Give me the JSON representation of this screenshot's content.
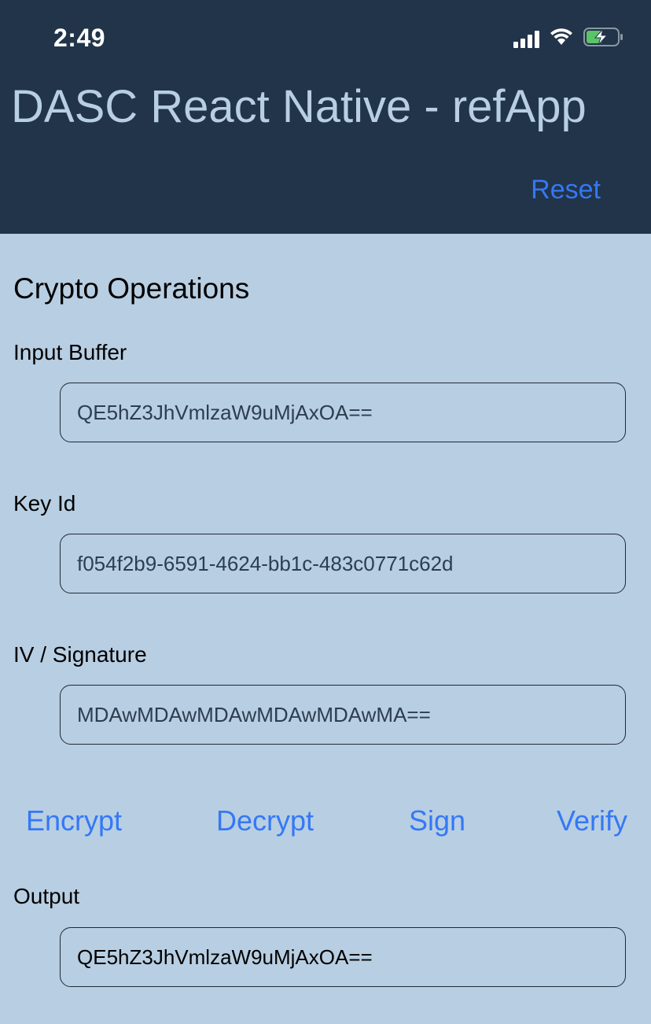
{
  "status_bar": {
    "time": "2:49",
    "icons": [
      "signal-icon",
      "wifi-icon",
      "battery-charging-icon"
    ]
  },
  "header": {
    "title": "DASC React Native - refApp",
    "reset_label": "Reset",
    "background": "#213449",
    "title_color": "#b8cee2"
  },
  "main": {
    "background": "#b8cee2",
    "section_title": "Crypto Operations",
    "input_buffer": {
      "label": "Input Buffer",
      "value": "QE5hZ3JhVmlzaW9uMjAxOA=="
    },
    "key_id": {
      "label": "Key Id",
      "value": "f054f2b9-6591-4624-bb1c-483c0771c62d"
    },
    "iv_signature": {
      "label": "IV / Signature",
      "value": "MDAwMDAwMDAwMDAwMDAwMA=="
    },
    "actions": {
      "encrypt": "Encrypt",
      "decrypt": "Decrypt",
      "sign": "Sign",
      "verify": "Verify"
    },
    "output": {
      "label": "Output",
      "value": "QE5hZ3JhVmlzaW9uMjAxOA=="
    },
    "accent_color": "#3478f6"
  }
}
